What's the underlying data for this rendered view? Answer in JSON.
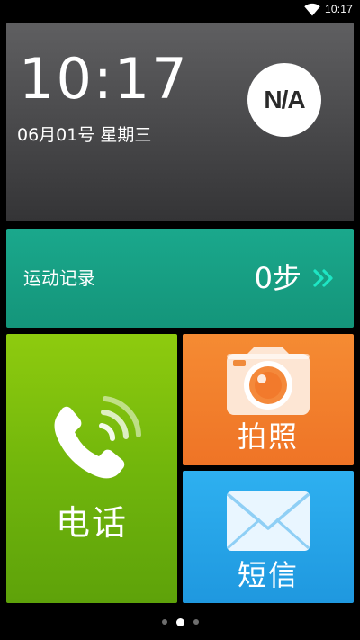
{
  "status_bar": {
    "time": "10:17",
    "wifi_icon": "wifi-icon"
  },
  "clock": {
    "time": "10:17",
    "date": "06月01号 星期三",
    "weather": "N/A"
  },
  "steps": {
    "label": "运动记录",
    "count": "0步",
    "chevron_icon": "double-chevron-right-icon",
    "accent_color": "#1ee6c4"
  },
  "tiles": {
    "phone": {
      "label": "电话",
      "icon": "phone-icon",
      "color": "#7dc00c"
    },
    "camera": {
      "label": "拍照",
      "icon": "camera-icon",
      "color": "#f2802c"
    },
    "sms": {
      "label": "短信",
      "icon": "envelope-icon",
      "color": "#27a5e8"
    }
  },
  "pager": {
    "page_count": 3,
    "active_index": 1
  }
}
